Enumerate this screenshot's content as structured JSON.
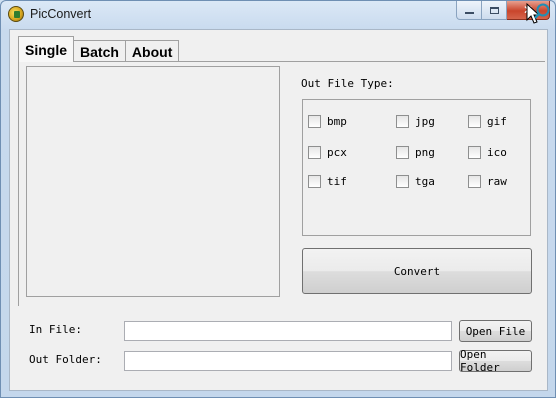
{
  "window": {
    "title": "PicConvert",
    "controls": {
      "minimize": "minimize-icon",
      "maximize": "maximize-icon",
      "close": "✕"
    }
  },
  "tabs": [
    {
      "label": "Single",
      "active": true
    },
    {
      "label": "Batch",
      "active": false
    },
    {
      "label": "About",
      "active": false
    }
  ],
  "output": {
    "group_label": "Out File Type:",
    "types": [
      {
        "label": "bmp",
        "checked": false
      },
      {
        "label": "jpg",
        "checked": false
      },
      {
        "label": "gif",
        "checked": false
      },
      {
        "label": "pcx",
        "checked": false
      },
      {
        "label": "png",
        "checked": false
      },
      {
        "label": "ico",
        "checked": false
      },
      {
        "label": "tif",
        "checked": false
      },
      {
        "label": "tga",
        "checked": false
      },
      {
        "label": "raw",
        "checked": false
      }
    ]
  },
  "actions": {
    "convert_label": "Convert",
    "open_file_label": "Open File",
    "open_folder_label": "Open Folder"
  },
  "fields": {
    "in_file_label": "In File:",
    "in_file_value": "",
    "out_folder_label": "Out Folder:",
    "out_folder_value": ""
  },
  "colors": {
    "accent": "#2f7d2f",
    "close_button": "#c9452c"
  }
}
